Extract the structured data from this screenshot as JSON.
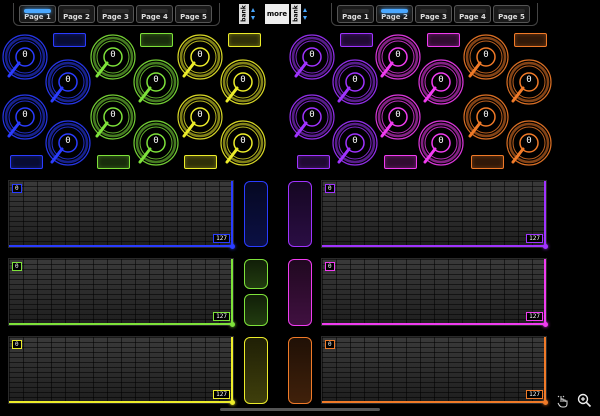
{
  "left_tabs": [
    "Page 1",
    "Page 2",
    "Page 3",
    "Page 4",
    "Page 5"
  ],
  "right_tabs": [
    "Page 1",
    "Page 2",
    "Page 3",
    "Page 4",
    "Page 5"
  ],
  "left_active_tab": 0,
  "right_active_tab": 1,
  "bank_label": "bank",
  "more_label": "more",
  "knob_value": "0",
  "xy_min": "0",
  "xy_max": "127",
  "colors": {
    "blue": "#2a3cff",
    "green": "#7ee23a",
    "yellow": "#ecec2a",
    "purple": "#a033ff",
    "magenta": "#f03cf0",
    "orange": "#f07a28"
  }
}
